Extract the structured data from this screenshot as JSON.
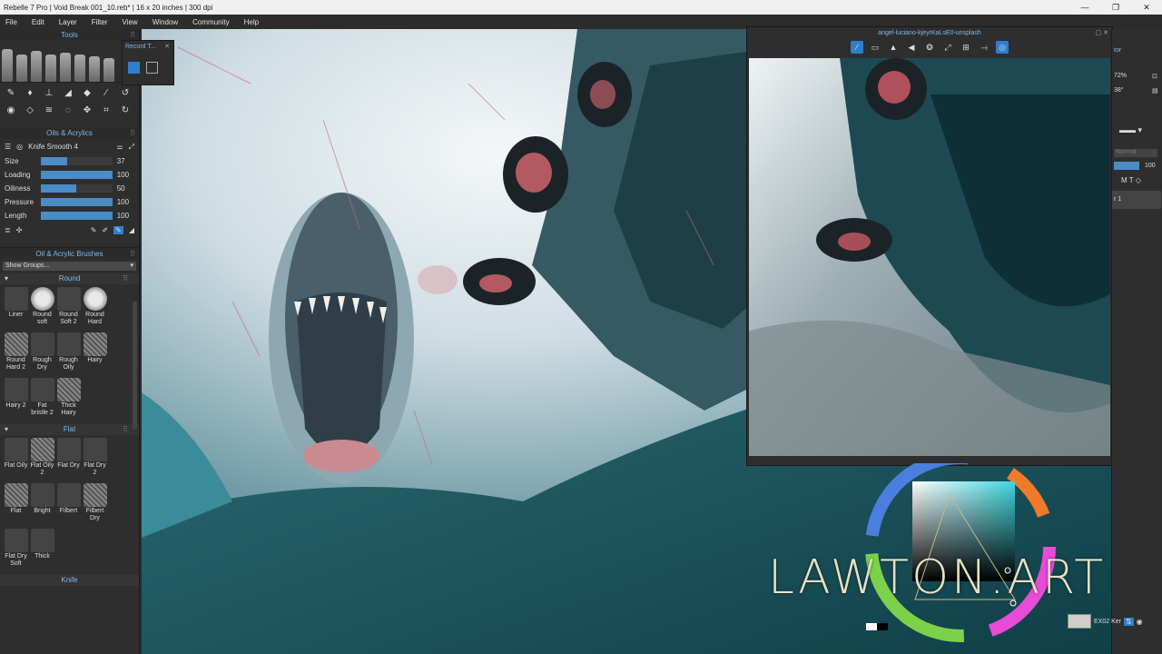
{
  "window": {
    "title": "Rebelle 7 Pro | Void Break 001_10.reb* | 16 x 20 inches | 300 dpi"
  },
  "menu": [
    "File",
    "Edit",
    "Layer",
    "Filter",
    "View",
    "Window",
    "Community",
    "Help"
  ],
  "tools_panel": {
    "title": "Tools"
  },
  "record_panel": {
    "title": "Record T..."
  },
  "oils_panel": {
    "title": "Oils & Acrylics",
    "brush_name": "Knife Smooth 4",
    "props": [
      {
        "label": "Size",
        "value": "37",
        "level": 0.37
      },
      {
        "label": "Loading",
        "value": "100",
        "level": 1.0
      },
      {
        "label": "Oiliness",
        "value": "50",
        "level": 0.5
      },
      {
        "label": "Pressure",
        "value": "100",
        "level": 1.0
      },
      {
        "label": "Length",
        "value": "100",
        "level": 1.0
      }
    ]
  },
  "brushes_panel": {
    "title": "Oil & Acrylic Brushes",
    "group_select": "Show Groups...",
    "groups": [
      {
        "name": "Round",
        "items": [
          "Liner",
          "Round soft",
          "Round Soft 2",
          "Round Hard",
          "Round Hard 2",
          "Rough Dry",
          "Rough Oily",
          "Hairy",
          "Hairy 2",
          "Fat bristle 2",
          "Thick Hairy"
        ]
      },
      {
        "name": "Flat",
        "items": [
          "Flat Oily",
          "Flat Oily 2",
          "Flat Dry",
          "Flat Dry 2",
          "Flat",
          "Bright",
          "Filbert",
          "Filbert Dry",
          "Flat Dry Soft",
          "Thick"
        ]
      }
    ],
    "next_group": "Knife"
  },
  "reference": {
    "title": "angel-luciano-kjeyrKaLsE0-unsplash"
  },
  "right_panel": {
    "label_top": "tor",
    "zoom": "72%",
    "angle": "38°",
    "blend": "Normal",
    "opacity": "100",
    "layer": "r 1"
  },
  "status": {
    "brush": "EX02 Ker"
  },
  "watermark": "LAWTON.ART",
  "colors": {
    "accent": "#4a8cc6",
    "title_blue": "#7fb8e8",
    "panel": "#2e2e2e"
  }
}
